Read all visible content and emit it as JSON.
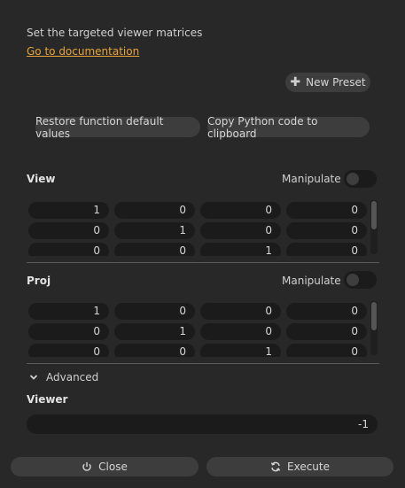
{
  "description": "Set the targeted viewer matrices",
  "doc_link": "Go to documentation",
  "presets": {
    "new_label": "New Preset",
    "icon": "plus-icon"
  },
  "actions": {
    "restore_label": "Restore function default values",
    "copy_label": "Copy Python code to clipboard"
  },
  "view": {
    "title": "View",
    "manipulate_label": "Manipulate",
    "manipulate_on": false,
    "rows": [
      [
        "1",
        "0",
        "0",
        "0"
      ],
      [
        "0",
        "1",
        "0",
        "0"
      ],
      [
        "0",
        "0",
        "1",
        "0"
      ]
    ]
  },
  "proj": {
    "title": "Proj",
    "manipulate_label": "Manipulate",
    "manipulate_on": false,
    "rows": [
      [
        "1",
        "0",
        "0",
        "0"
      ],
      [
        "0",
        "1",
        "0",
        "0"
      ],
      [
        "0",
        "0",
        "1",
        "0"
      ]
    ]
  },
  "advanced": {
    "label": "Advanced",
    "icon": "chevron-down-icon",
    "expanded": true
  },
  "viewer": {
    "title": "Viewer",
    "value": "-1"
  },
  "footer": {
    "close_label": "Close",
    "close_icon": "power-icon",
    "execute_label": "Execute",
    "execute_icon": "refresh-icon"
  },
  "colors": {
    "link": "#e8a43a",
    "background": "#282828",
    "field": "#1b1b1b",
    "button": "#3d3d3d"
  }
}
